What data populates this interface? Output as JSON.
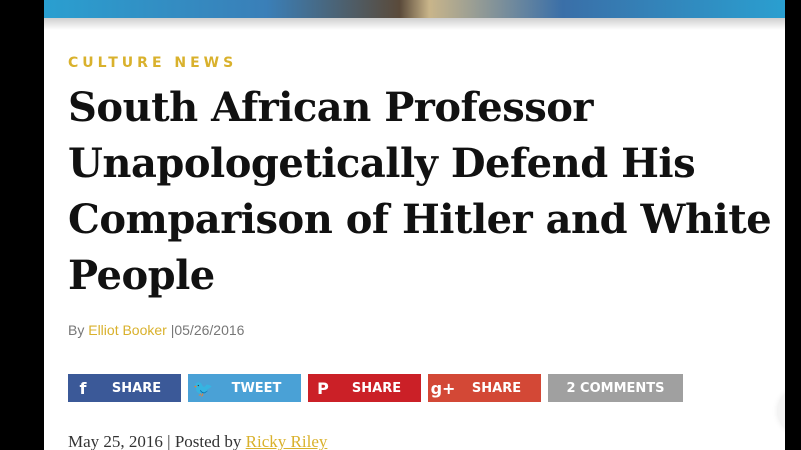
{
  "article": {
    "category": "CULTURE NEWS",
    "title": "South African Professor Unapologetically Defend His Comparison of Hitler and White People",
    "byline_prefix": "By",
    "author": "Elliot Booker",
    "separator": "|",
    "date": "05/26/2016"
  },
  "share": {
    "facebook": {
      "icon": "f",
      "label": "SHARE"
    },
    "twitter": {
      "icon": "🐦",
      "label": "TWEET"
    },
    "pinterest": {
      "icon": "P",
      "label": "SHARE"
    },
    "googleplus": {
      "icon": "g+",
      "label": "SHARE"
    },
    "comments": {
      "label": "2 COMMENTS"
    }
  },
  "body": {
    "posted_date": "May 25, 2016",
    "posted_sep": "|",
    "posted_prefix": "Posted by",
    "poster": "Ricky Riley"
  },
  "colors": {
    "accent": "#d9b12c",
    "facebook": "#3b5998",
    "twitter": "#4aa1d6",
    "pinterest": "#cb2027",
    "googleplus": "#d34836",
    "comments": "#a0a0a0"
  }
}
